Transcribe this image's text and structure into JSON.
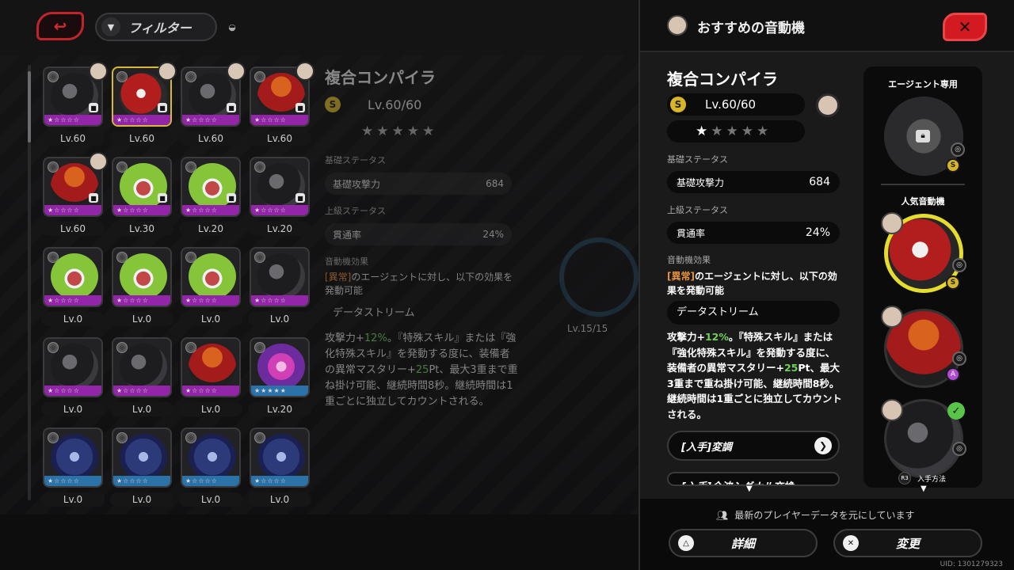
{
  "topbar": {
    "filter_label": "フィルター"
  },
  "grid": {
    "items": [
      {
        "level": "Lv.60",
        "art": "black",
        "rarity": "S",
        "stars": "★☆☆☆☆",
        "face": true,
        "locked": true,
        "selected": false
      },
      {
        "level": "Lv.60",
        "art": "red",
        "rarity": "S",
        "stars": "★☆☆☆☆",
        "face": true,
        "locked": true,
        "selected": true
      },
      {
        "level": "Lv.60",
        "art": "black",
        "rarity": "S",
        "stars": "★☆☆☆☆",
        "face": true,
        "locked": true,
        "selected": false
      },
      {
        "level": "Lv.60",
        "art": "orange",
        "rarity": "S",
        "stars": "★☆☆☆☆",
        "face": true,
        "locked": true,
        "selected": false
      },
      {
        "level": "Lv.60",
        "art": "orange",
        "rarity": "S",
        "stars": "★☆☆☆☆",
        "face": true,
        "locked": true,
        "selected": false
      },
      {
        "level": "Lv.30",
        "art": "green",
        "rarity": "S",
        "stars": "★☆☆☆☆",
        "face": false,
        "locked": true,
        "selected": false
      },
      {
        "level": "Lv.20",
        "art": "green",
        "rarity": "S",
        "stars": "★☆☆☆☆",
        "face": false,
        "locked": true,
        "selected": false
      },
      {
        "level": "Lv.20",
        "art": "black",
        "rarity": "S",
        "stars": "★☆☆☆☆",
        "face": false,
        "locked": true,
        "selected": false
      },
      {
        "level": "Lv.0",
        "art": "green",
        "rarity": "S",
        "stars": "★☆☆☆☆",
        "face": false,
        "locked": false,
        "selected": false
      },
      {
        "level": "Lv.0",
        "art": "green",
        "rarity": "S",
        "stars": "★☆☆☆☆",
        "face": false,
        "locked": false,
        "selected": false
      },
      {
        "level": "Lv.0",
        "art": "green",
        "rarity": "S",
        "stars": "★☆☆☆☆",
        "face": false,
        "locked": false,
        "selected": false
      },
      {
        "level": "Lv.0",
        "art": "black",
        "rarity": "S",
        "stars": "★☆☆☆☆",
        "face": false,
        "locked": false,
        "selected": false
      },
      {
        "level": "Lv.0",
        "art": "black",
        "rarity": "S",
        "stars": "★☆☆☆☆",
        "face": false,
        "locked": false,
        "selected": false
      },
      {
        "level": "Lv.0",
        "art": "black",
        "rarity": "S",
        "stars": "★☆☆☆☆",
        "face": false,
        "locked": false,
        "selected": false
      },
      {
        "level": "Lv.0",
        "art": "orange",
        "rarity": "S",
        "stars": "★☆☆☆☆",
        "face": false,
        "locked": false,
        "selected": false
      },
      {
        "level": "Lv.20",
        "art": "purple",
        "rarity": "B",
        "stars": "★★★★★",
        "face": false,
        "locked": false,
        "selected": false
      },
      {
        "level": "Lv.0",
        "art": "blue",
        "rarity": "B",
        "stars": "★☆☆☆☆",
        "face": false,
        "locked": false,
        "selected": false
      },
      {
        "level": "Lv.0",
        "art": "blue",
        "rarity": "B",
        "stars": "★☆☆☆☆",
        "face": false,
        "locked": false,
        "selected": false
      },
      {
        "level": "Lv.0",
        "art": "blue",
        "rarity": "B",
        "stars": "★☆☆☆☆",
        "face": false,
        "locked": false,
        "selected": false
      },
      {
        "level": "Lv.0",
        "art": "blue",
        "rarity": "B",
        "stars": "★☆☆☆☆",
        "face": false,
        "locked": false,
        "selected": false
      }
    ]
  },
  "detail": {
    "name": "複合コンパイラ",
    "level": "Lv.60/60",
    "coin_letter": "S",
    "stars_filled": "★",
    "stars_empty": "★★★★",
    "base_section": "基礎ステータス",
    "base_stat_name": "基礎攻撃力",
    "base_stat_value": "684",
    "adv_section": "上級ステータス",
    "adv_stat_name": "貫通率",
    "adv_stat_value": "24%",
    "effect_section": "音動機効果",
    "effect_tag": "[異常]",
    "effect_text": "のエージェントに対し、以下の効果を発動可能",
    "effect_name": "データストリーム",
    "desc_1": "攻撃力+",
    "desc_pct": "12%",
    "desc_2": "。『特殊スキル』または『強化特殊スキル』を発動する度に、装備者の異常マスタリー+",
    "desc_pt": "25",
    "desc_3": "Pt、最大3重まで重ね掛け可能、継続時間8秒。継続時間は1重ごとに独立してカウントされる。"
  },
  "background": {
    "ghost_level": "Lv.15/15"
  },
  "panel": {
    "title": "おすすめの音動機",
    "close_label": "✕",
    "acquire_btn": "[入手]変調",
    "acquire_btn_2": "[入手]全波シグナル交換",
    "column": {
      "agent_only": "エージェント専用",
      "popular": "人気音動機",
      "r3_label": "R3",
      "how_to_get": "入手方法"
    },
    "note": "最新のプレイヤーデータを元にしています",
    "detail_btn": "詳細",
    "change_btn": "変更",
    "uid": "UID: 1301279323"
  }
}
